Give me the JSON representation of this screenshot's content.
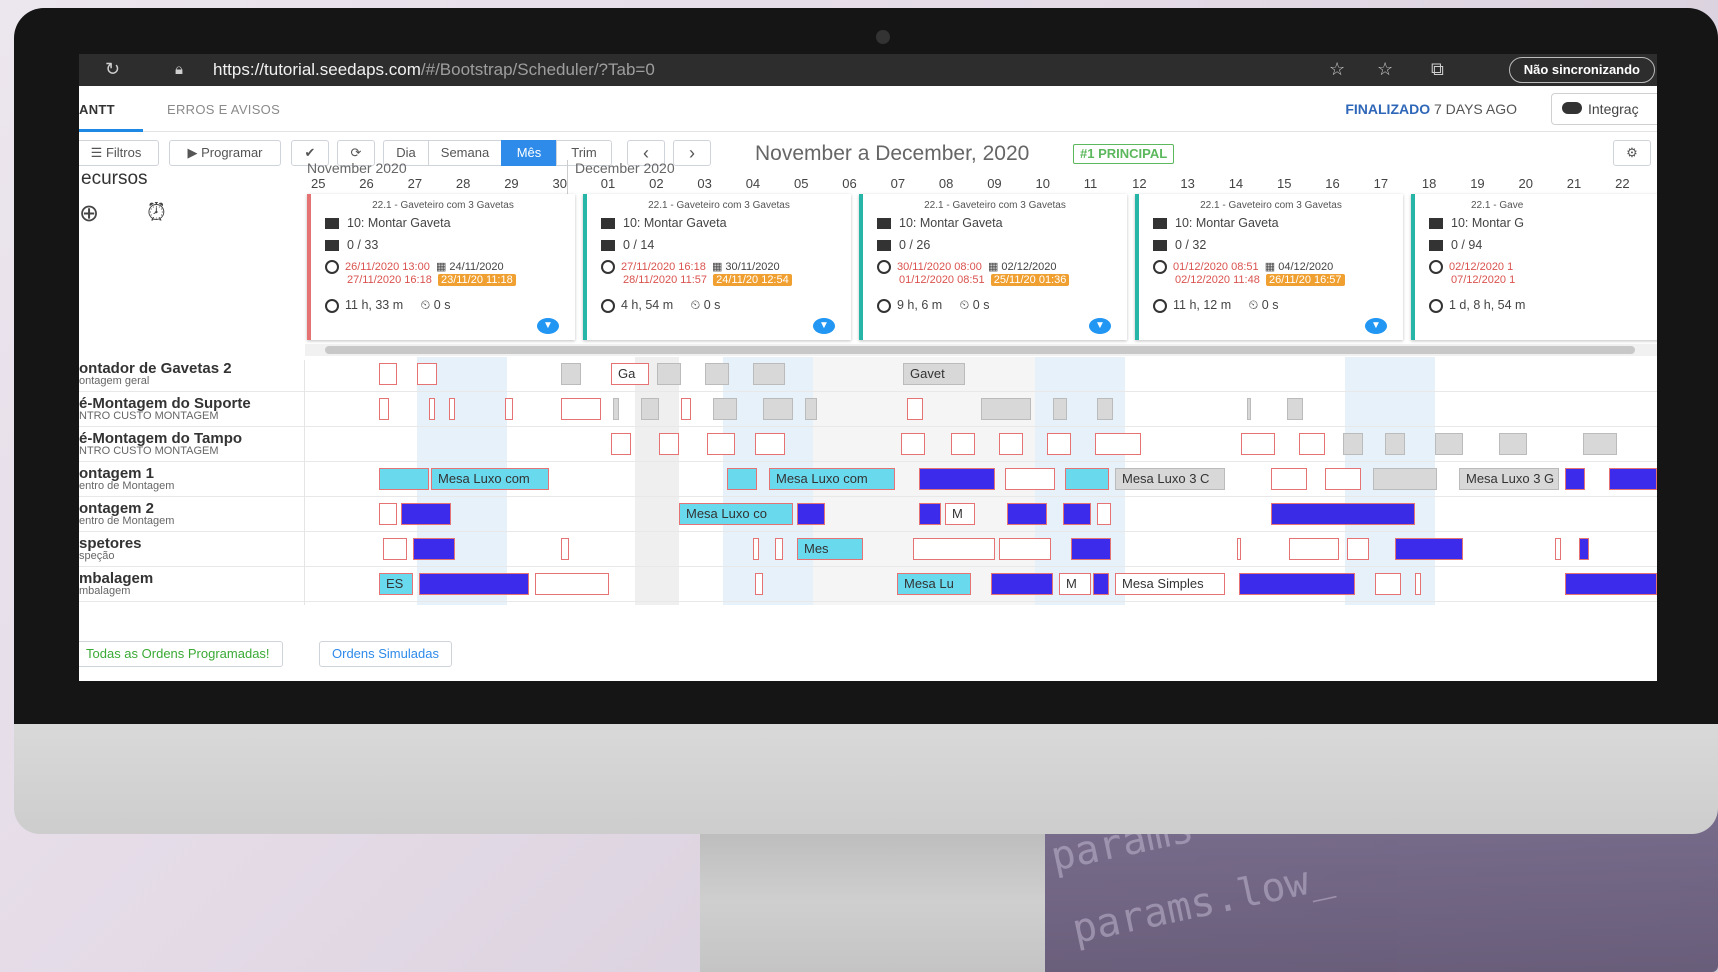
{
  "browser": {
    "url_main": "https://tutorial.seedaps.com",
    "url_path": "/#/Bootstrap/Scheduler/?Tab=0",
    "sync_label": "Não sincronizando"
  },
  "tabs": [
    {
      "label": "ANTT"
    },
    {
      "label": "ERROS E AVISOS"
    }
  ],
  "status": {
    "finalized": "FINALIZADO",
    "ago": "7 DAYS AGO"
  },
  "integration_label": "Integraç",
  "toolbar": {
    "filters": "Filtros",
    "schedule": "Programar",
    "check": "✔",
    "refresh": "⟳",
    "day": "Dia",
    "week": "Semana",
    "month": "Mês",
    "quarter": "Trim",
    "prev": "‹",
    "next": "›",
    "range_title": "November a December, 2020",
    "badge": "#1 PRINCIPAL",
    "settings": "⚙"
  },
  "resources_title": "ecursos",
  "timeline": {
    "months": [
      {
        "label": "November 2020"
      },
      {
        "label": "December 2020"
      }
    ],
    "days": [
      "25",
      "26",
      "27",
      "28",
      "29",
      "30",
      "01",
      "02",
      "03",
      "04",
      "05",
      "06",
      "07",
      "08",
      "09",
      "10",
      "11",
      "12",
      "13",
      "14",
      "15",
      "16",
      "17",
      "18",
      "19",
      "20",
      "21",
      "22"
    ]
  },
  "cards": [
    {
      "title": "22.1 - Gaveteiro com 3 Gavetas",
      "op": "10: Montar Gaveta",
      "qty": "0 / 33",
      "start1": "26/11/2020 13:00",
      "start2": "27/11/2020 16:18",
      "due": "24/11/2020",
      "due_badge": "23/11/20 11:18",
      "duration": "11 h, 33 m",
      "wait": "0 s"
    },
    {
      "title": "22.1 - Gaveteiro com 3 Gavetas",
      "op": "10: Montar Gaveta",
      "qty": "0 / 14",
      "start1": "27/11/2020 16:18",
      "start2": "28/11/2020 11:57",
      "due": "30/11/2020",
      "due_badge": "24/11/20 12:54",
      "duration": "4 h, 54 m",
      "wait": "0 s"
    },
    {
      "title": "22.1 - Gaveteiro com 3 Gavetas",
      "op": "10: Montar Gaveta",
      "qty": "0 / 26",
      "start1": "30/11/2020 08:00",
      "start2": "01/12/2020 08:51",
      "due": "02/12/2020",
      "due_badge": "25/11/20 01:36",
      "duration": "9 h, 6 m",
      "wait": "0 s"
    },
    {
      "title": "22.1 - Gaveteiro com 3 Gavetas",
      "op": "10: Montar Gaveta",
      "qty": "0 / 32",
      "start1": "01/12/2020 08:51",
      "start2": "02/12/2020 11:48",
      "due": "04/12/2020",
      "due_badge": "26/11/20 16:57",
      "duration": "11 h, 12 m",
      "wait": "0 s"
    },
    {
      "title": "22.1 - Gave",
      "op": "10: Montar G",
      "qty": "0 / 94",
      "start1": "02/12/2020 1",
      "start2": "07/12/2020 1",
      "due": "",
      "due_badge": "",
      "duration": "1 d, 8 h, 54 m",
      "wait": ""
    }
  ],
  "rows": [
    {
      "name": "ontador de Gavetas 2",
      "sub": "ontagem geral"
    },
    {
      "name": "é-Montagem do Suporte",
      "sub": "NTRO CUSTO MONTAGEM"
    },
    {
      "name": "é-Montagem do Tampo",
      "sub": "NTRO CUSTO MONTAGEM"
    },
    {
      "name": "ontagem 1",
      "sub": "entro de Montagem"
    },
    {
      "name": "ontagem 2",
      "sub": "entro de Montagem"
    },
    {
      "name": "spetores",
      "sub": "speção"
    },
    {
      "name": "mbalagem",
      "sub": "mbalagem"
    }
  ],
  "bar_labels": {
    "ga": "Ga",
    "gavet": "Gavet",
    "mesa_luxo_com": "Mesa Luxo com",
    "mesa_luxo_com2": "Mesa Luxo com",
    "mesa_luxo_3c": "Mesa Luxo 3 C",
    "mesa_luxo_3g": "Mesa Luxo 3 G",
    "mesa_luxo_co": "Mesa Luxo co",
    "m": "M",
    "mes": "Mes",
    "es": "ES",
    "mesa_lu": "Mesa Lu",
    "m2": "M",
    "mesa_simples": "Mesa Simples"
  },
  "footer": {
    "all_programmed": "Todas as Ordens Programadas!",
    "simulated": "Ordens Simuladas"
  },
  "colors": {
    "accent": "#2e8bea",
    "teal": "#26b5a6",
    "red": "#d9534f",
    "orange": "#f0a030",
    "green": "#5cb85c",
    "blue_bar": "#3c2bea"
  }
}
